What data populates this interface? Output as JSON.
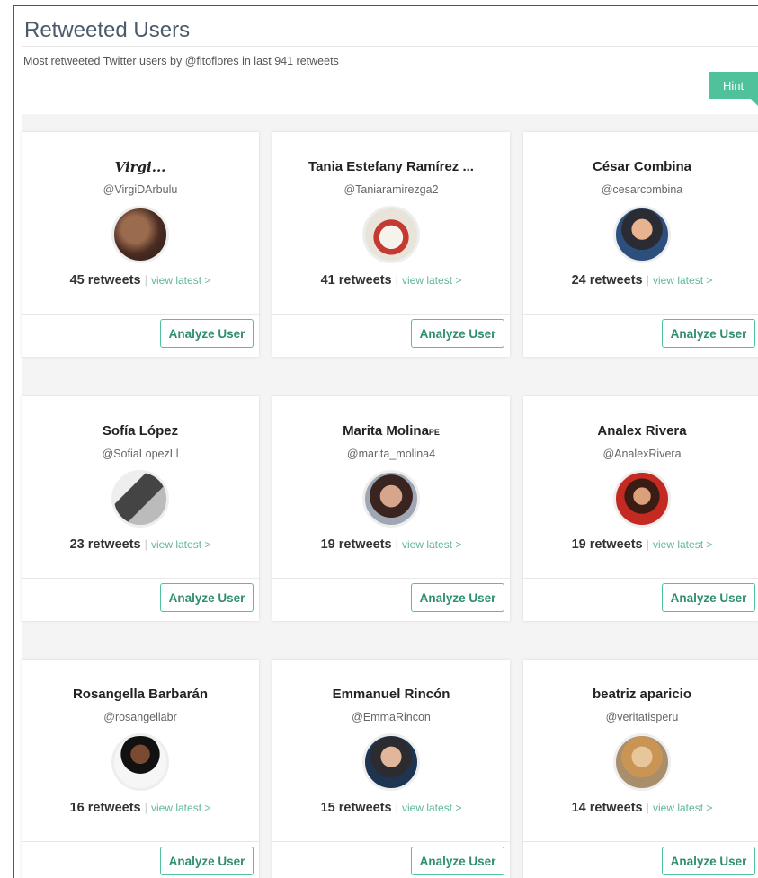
{
  "header": {
    "title": "Retweeted Users",
    "subtitle": "Most retweeted Twitter users by @fitoflores in last 941 retweets",
    "hint_label": "Hint"
  },
  "cards": [
    {
      "name": "Virgi...",
      "handle": "@VirgiDArbulu",
      "retweets": "45 retweets",
      "view_latest": "view latest >",
      "analyze": "Analyze User"
    },
    {
      "name": "Tania Estefany Ramírez ...",
      "handle": "@Taniaramirezga2",
      "retweets": "41 retweets",
      "view_latest": "view latest >",
      "analyze": "Analyze User"
    },
    {
      "name": "César Combina",
      "handle": "@cesarcombina",
      "retweets": "24 retweets",
      "view_latest": "view latest >",
      "analyze": "Analyze User"
    },
    {
      "name": "Sofía López",
      "handle": "@SofiaLopezLl",
      "retweets": "23 retweets",
      "view_latest": "view latest >",
      "analyze": "Analyze User"
    },
    {
      "name": "Marita Molina",
      "name_suffix": "PE",
      "handle": "@marita_molina4",
      "retweets": "19 retweets",
      "view_latest": "view latest >",
      "analyze": "Analyze User"
    },
    {
      "name": "Analex Rivera",
      "handle": "@AnalexRivera",
      "retweets": "19 retweets",
      "view_latest": "view latest >",
      "analyze": "Analyze User"
    },
    {
      "name": "Rosangella Barbarán",
      "handle": "@rosangellabr",
      "retweets": "16 retweets",
      "view_latest": "view latest >",
      "analyze": "Analyze User"
    },
    {
      "name": "Emmanuel Rincón",
      "handle": "@EmmaRincon",
      "retweets": "15 retweets",
      "view_latest": "view latest >",
      "analyze": "Analyze User"
    },
    {
      "name": "beatriz aparicio",
      "handle": "@veritatisperu",
      "retweets": "14 retweets",
      "view_latest": "view latest >",
      "analyze": "Analyze User"
    }
  ]
}
